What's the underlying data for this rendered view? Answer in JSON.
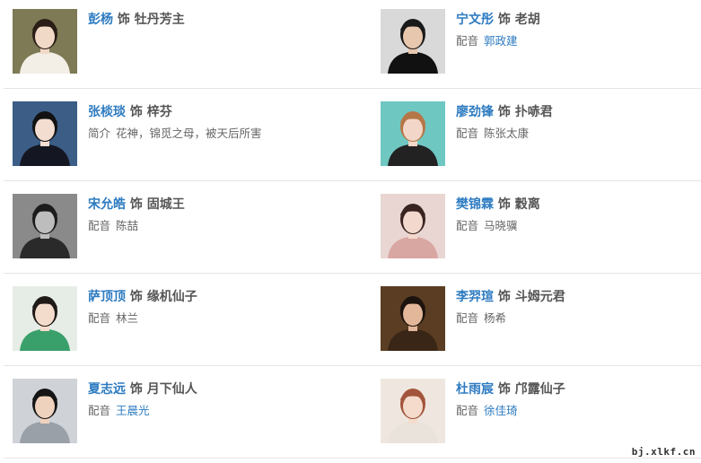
{
  "sep": "饰",
  "rows": [
    {
      "left": {
        "actor": "彭杨",
        "role": "牡丹芳主",
        "label": "",
        "value": "",
        "value_link": false,
        "photo": {
          "bg": "#7d7a55",
          "skin": "#f1d9c8",
          "hair": "#2b1e16",
          "cloth": "#f3efe6"
        }
      },
      "right": {
        "actor": "宁文彤",
        "role": "老胡",
        "label": "配音",
        "value": "郭政建",
        "value_link": true,
        "photo": {
          "bg": "#d9d9d9",
          "skin": "#e7c7ae",
          "hair": "#1a1a1a",
          "cloth": "#111111"
        }
      }
    },
    {
      "left": {
        "actor": "张棪琰",
        "role": "梓芬",
        "label": "简介",
        "value": "花神，锦觅之母，被天后所害",
        "value_link": false,
        "photo": {
          "bg": "#3b5d86",
          "skin": "#f3ddd0",
          "hair": "#121212",
          "cloth": "#141722"
        }
      },
      "right": {
        "actor": "廖劲锋",
        "role": "扑哧君",
        "label": "配音",
        "value": "陈张太康",
        "value_link": false,
        "photo": {
          "bg": "#6fc7c2",
          "skin": "#f2d7c8",
          "hair": "#b57748",
          "cloth": "#222222"
        }
      }
    },
    {
      "left": {
        "actor": "宋允皓",
        "role": "固城王",
        "label": "配音",
        "value": "陈喆",
        "value_link": false,
        "photo": {
          "bg": "#8a8a8a",
          "skin": "#bdbdbd",
          "hair": "#1c1c1c",
          "cloth": "#2a2a2a"
        }
      },
      "right": {
        "actor": "樊锦霖",
        "role": "穀离",
        "label": "配音",
        "value": "马晓骥",
        "value_link": false,
        "photo": {
          "bg": "#e9d6d3",
          "skin": "#f3d8cd",
          "hair": "#3a2420",
          "cloth": "#d9a7a2"
        }
      }
    },
    {
      "left": {
        "actor": "萨顶顶",
        "role": "缘机仙子",
        "label": "配音",
        "value": "林兰",
        "value_link": false,
        "photo": {
          "bg": "#e6ece6",
          "skin": "#f4dccc",
          "hair": "#1f1a17",
          "cloth": "#3aa06b"
        }
      },
      "right": {
        "actor": "李羿瑄",
        "role": "斗姆元君",
        "label": "配音",
        "value": "杨希",
        "value_link": false,
        "photo": {
          "bg": "#5a3d22",
          "skin": "#e3b79a",
          "hair": "#1d130e",
          "cloth": "#3a2616"
        }
      }
    },
    {
      "left": {
        "actor": "夏志远",
        "role": "月下仙人",
        "label": "配音",
        "value": "王晨光",
        "value_link": true,
        "photo": {
          "bg": "#cfd3d8",
          "skin": "#efd2bd",
          "hair": "#151515",
          "cloth": "#9aa0a8"
        }
      },
      "right": {
        "actor": "杜雨宸",
        "role": "邝露仙子",
        "label": "配音",
        "value": "徐佳琦",
        "value_link": true,
        "photo": {
          "bg": "#efe7df",
          "skin": "#f4dbcc",
          "hair": "#a2553c",
          "cloth": "#e9e3dc"
        }
      }
    }
  ],
  "watermark": "bj.xlkf.cn"
}
